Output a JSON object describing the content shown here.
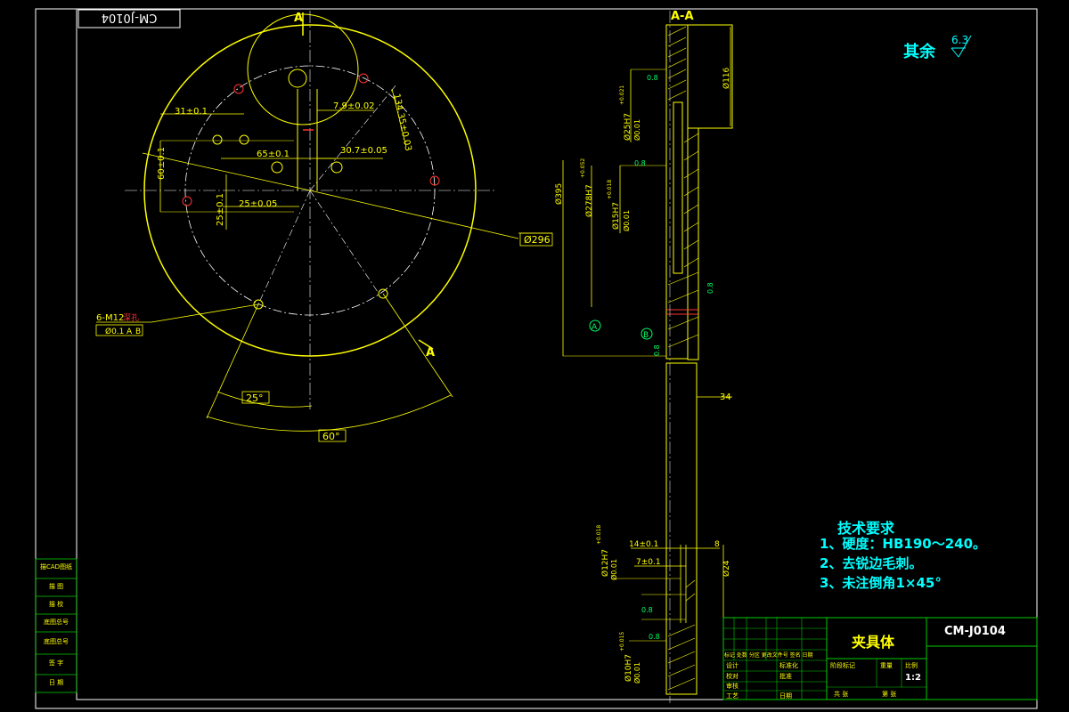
{
  "drawing": {
    "code": "CM-J0104",
    "mirrored_code": "CM-J0104",
    "part_name": "夹具体",
    "scale": "1:2"
  },
  "surface_finish": {
    "label": "其余",
    "value": "6.3"
  },
  "section_label": "A-A",
  "section_marks": {
    "A": "A",
    "B": "B"
  },
  "front_view": {
    "dimensions": {
      "d1": "7.9±0.02",
      "d2": "31±0.1",
      "d3": "134.35±0.03",
      "d4": "65±0.1",
      "d5": "30.7±0.05",
      "d6": "60±0.1",
      "d7": "25±0.1",
      "d8": "25±0.05",
      "d9": "Ø296",
      "d10": "6-M12",
      "d10b": "深孔",
      "d11": "Ø0.1",
      "d11a": "A",
      "d11b": "B",
      "ang1": "25°",
      "ang2": "60°"
    }
  },
  "section_view": {
    "dimensions": {
      "s1": "Ø116",
      "s2": "0.8",
      "s3": "Ø25H7",
      "s3b": "+0.021",
      "s4": "Ø0.01",
      "s5": "0.8",
      "s6": "Ø395",
      "s7": "Ø278H7",
      "s7b": "+0.052",
      "s8": "Ø15H7",
      "s8b": "+0.018",
      "s9": "Ø0.01",
      "s10": "0.8",
      "s11": "0.8",
      "s12": "34",
      "s13": "14±0.1",
      "s14": "8",
      "s15": "7±0.1",
      "s16": "Ø12H7",
      "s16b": "+0.018",
      "s17": "Ø0.01",
      "s18": "Ø24",
      "s19": "0.8",
      "s20": "0.8",
      "s21": "Ø10H7",
      "s21b": "+0.015",
      "s22": "Ø0.01"
    }
  },
  "tech_requirements": {
    "title": "技术要求",
    "items": [
      "1、硬度：HB190～240。",
      "2、去锐边毛刺。",
      "3、未注倒角1×45°"
    ]
  },
  "title_block": {
    "cells": {
      "c1": "标记 处数 分区 更改文件号 签名 日期",
      "c2": "设计",
      "c3": "标准化",
      "c4": "阶段标记",
      "c5": "重量",
      "c6": "比例",
      "c7": "校对",
      "c8": "批准",
      "c9": "审核",
      "c10": "工艺",
      "c11": "日期",
      "c12": "共 张",
      "c13": "第 张"
    }
  },
  "side_stamps": [
    "描CAD图纸",
    "描 图",
    "描 校",
    "底图总号",
    "底图总号",
    "签 字",
    "日 期"
  ],
  "colors": {
    "line": "#ffff00",
    "text_cyan": "#00ffff",
    "frame": "#ffffff",
    "title_green": "#00cc00",
    "center": "#ffffff",
    "accent": "#ff3333"
  }
}
